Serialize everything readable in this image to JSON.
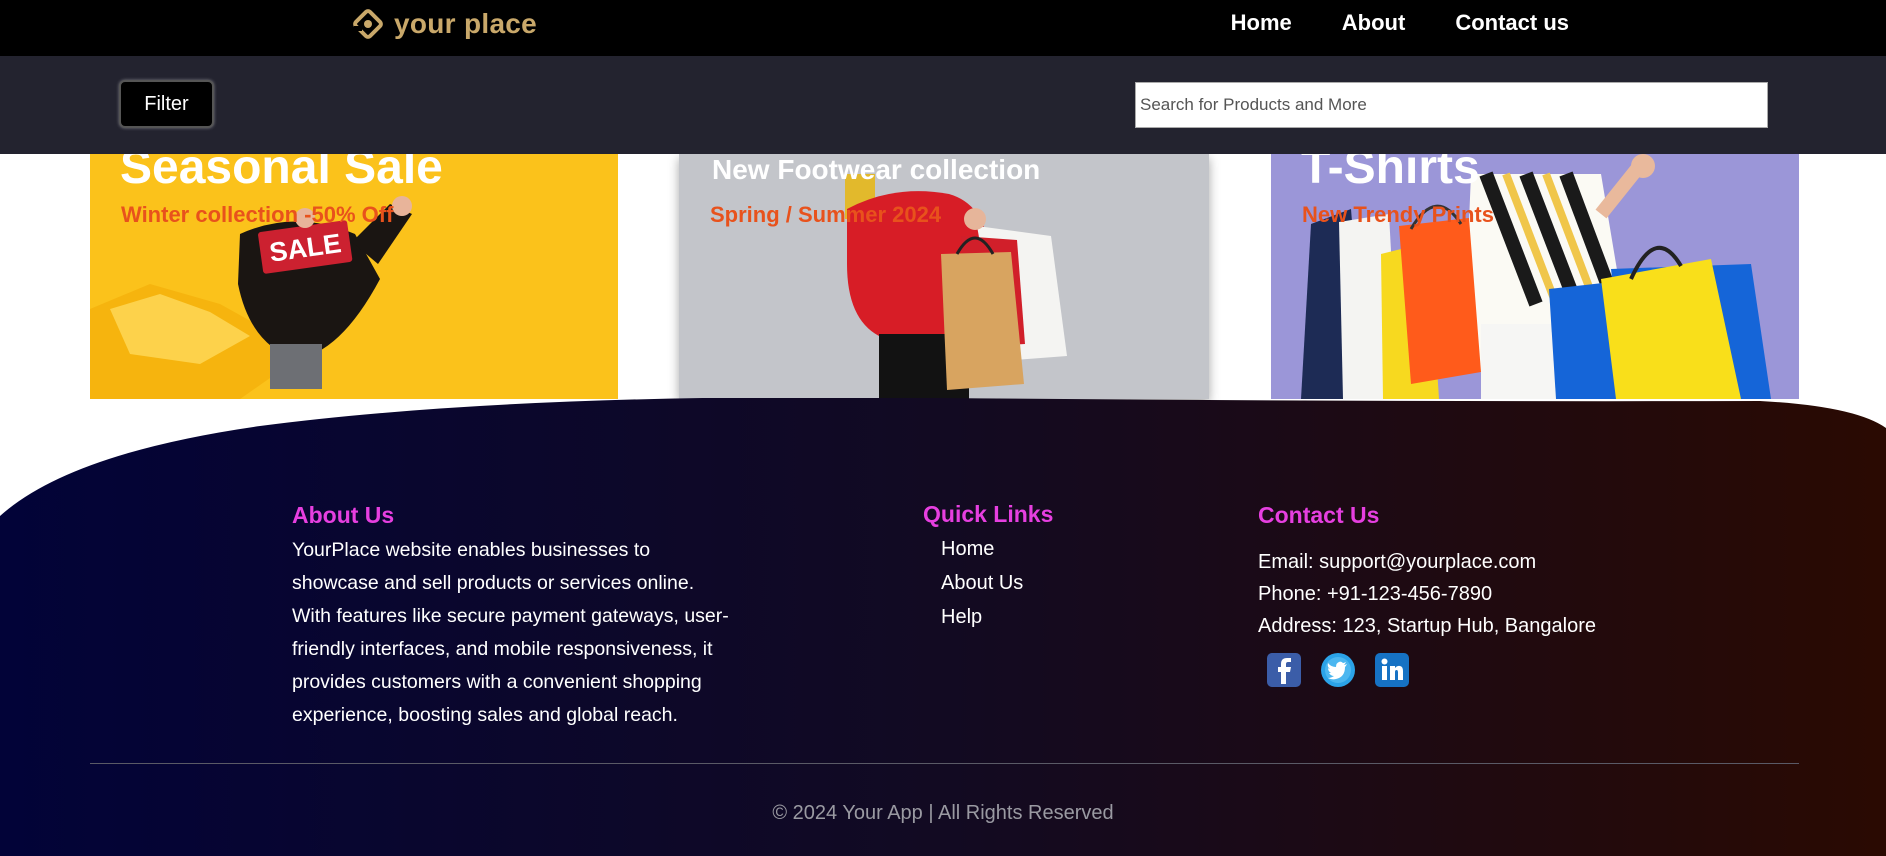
{
  "brand": {
    "name": "your place"
  },
  "nav": {
    "items": [
      "Home",
      "About",
      "Contact us"
    ]
  },
  "toolbar": {
    "filter_label": "Filter",
    "search_placeholder": "Search for Products and More"
  },
  "cards": [
    {
      "title": "Seasonal Sale",
      "subtitle": "Winter collection -50% Off",
      "sign_text": "SALE"
    },
    {
      "title": "New Footwear collection",
      "subtitle": "Spring / Summer 2024"
    },
    {
      "title": "T-Shirts",
      "subtitle": "New Trendy Prints"
    }
  ],
  "footer": {
    "about": {
      "title": "About Us",
      "text": "YourPlace website enables businesses to showcase and sell products or services online. With features like secure payment gateways, user-friendly interfaces, and mobile responsiveness, it provides customers with a convenient shopping experience, boosting sales and global reach."
    },
    "links": {
      "title": "Quick Links",
      "items": [
        "Home",
        "About Us",
        "Help"
      ]
    },
    "contact": {
      "title": "Contact Us",
      "email": "Email: support@yourplace.com",
      "phone": "Phone: +91-123-456-7890",
      "address": "Address: 123, Startup Hub, Bangalore"
    },
    "socials": [
      "facebook-icon",
      "twitter-icon",
      "linkedin-icon"
    ],
    "copyright": "© 2024 Your App | All Rights Reserved"
  },
  "colors": {
    "nav_bg": "#000000",
    "toolbar_bg": "#23232f",
    "logo": "#c9a86a",
    "accent_heading": "#e63fe0",
    "card_subtitle": "#e8521c",
    "footer_gradient_start": "#020338",
    "footer_gradient_end": "#2a0a02"
  }
}
